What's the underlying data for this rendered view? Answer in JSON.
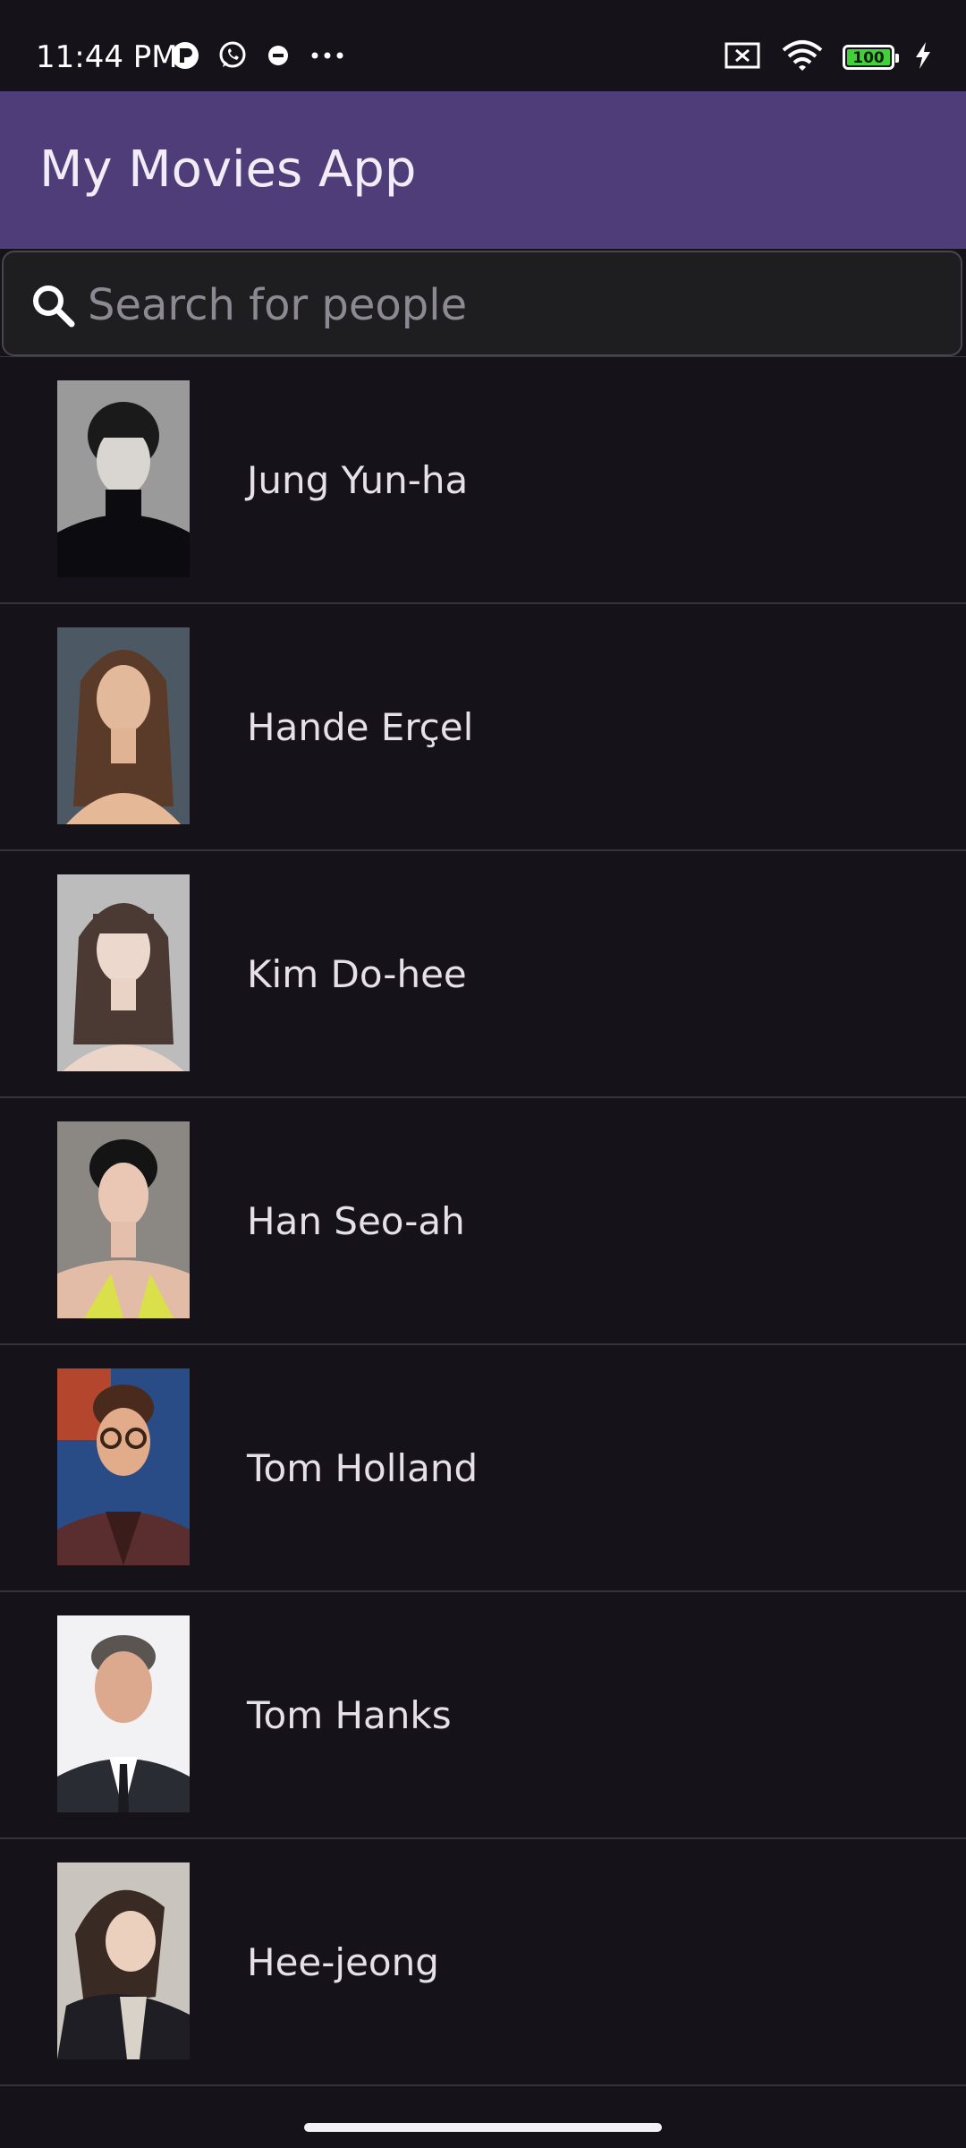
{
  "status_bar": {
    "time": "11:44 PM",
    "battery_level": "100",
    "left_icons": [
      "profile-badge-icon",
      "whatsapp-icon",
      "dnd-timer-icon",
      "more-dots-icon"
    ],
    "right_icons": [
      "no-sim-icon",
      "wifi-icon",
      "battery-icon",
      "charging-bolt-icon"
    ]
  },
  "app_bar": {
    "title": "My Movies App",
    "color": "#4f3d79"
  },
  "search": {
    "placeholder": "Search for people",
    "value": ""
  },
  "people": [
    {
      "name": "Jung Yun-ha"
    },
    {
      "name": "Hande Erçel"
    },
    {
      "name": "Kim Do-hee"
    },
    {
      "name": "Han Seo-ah"
    },
    {
      "name": "Tom Holland"
    },
    {
      "name": "Tom Hanks"
    },
    {
      "name": "Hee-jeong"
    }
  ],
  "colors": {
    "background": "#15121a",
    "divider": "#36333b",
    "text": "#e6e1e8",
    "placeholder": "#8d8992"
  }
}
